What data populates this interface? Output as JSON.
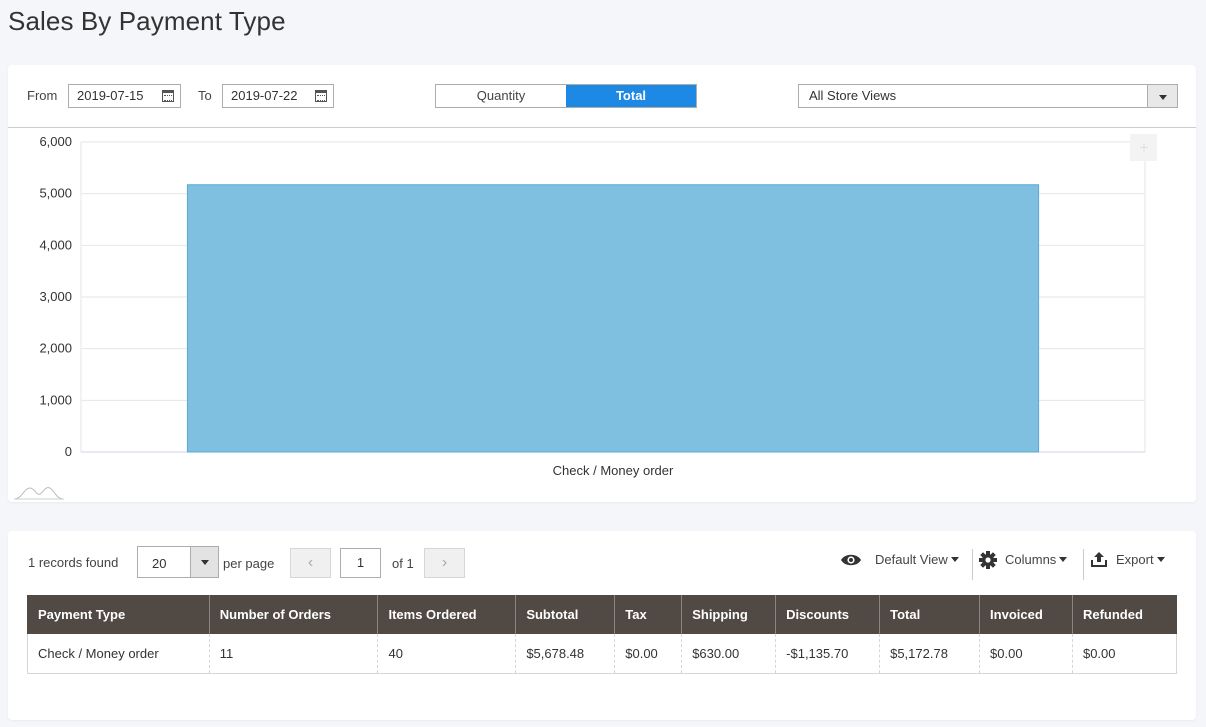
{
  "page": {
    "title": "Sales By Payment Type"
  },
  "filters": {
    "from_label": "From",
    "from_value": "2019-07-15",
    "to_label": "To",
    "to_value": "2019-07-22",
    "toggle": [
      "Quantity",
      "Total"
    ],
    "toggle_active": "Total",
    "store_view": "All Store Views"
  },
  "chart_data": {
    "type": "bar",
    "categories": [
      "Check / Money order"
    ],
    "values": [
      5172.78
    ],
    "ylim": [
      0,
      6000
    ],
    "yticks": [
      "0",
      "1,000",
      "2,000",
      "3,000",
      "4,000",
      "5,000",
      "6,000"
    ],
    "grid": true,
    "bar_color": "#7fc0e1",
    "bar_border": "#5aa9d4"
  },
  "grid_toolbar": {
    "records_found": "1 records found",
    "per_page_value": "20",
    "per_page_label": "per page",
    "prev": "‹",
    "next": "›",
    "page_value": "1",
    "of_pages": "of 1",
    "default_view": "Default View",
    "columns": "Columns",
    "export": "Export",
    "icons": [
      "eye-icon",
      "gear-icon",
      "export-icon"
    ]
  },
  "table": {
    "headers": [
      "Payment Type",
      "Number of Orders",
      "Items Ordered",
      "Subtotal",
      "Tax",
      "Shipping",
      "Discounts",
      "Total",
      "Invoiced",
      "Refunded"
    ],
    "rows": [
      [
        "Check / Money order",
        "11",
        "40",
        "$5,678.48",
        "$0.00",
        "$630.00",
        "-$1,135.70",
        "$5,172.78",
        "$0.00",
        "$0.00"
      ]
    ],
    "header_bg": "#514943"
  }
}
